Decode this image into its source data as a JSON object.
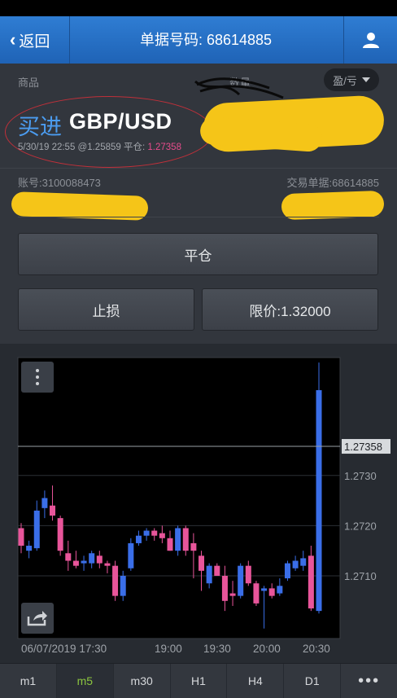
{
  "nav": {
    "back_label": "返回",
    "title": "单据号码: 68614885"
  },
  "header": {
    "product_label": "商品",
    "quantity_label": "数量",
    "pl_select": "盈/亏"
  },
  "trade": {
    "side": "买进",
    "symbol": "GBP/USD",
    "datetime": "5/30/19 22:55",
    "open_price": "@1.25859",
    "close_label": "平仓:",
    "close_price": "1.27358"
  },
  "account": {
    "account_label": "账号:3100088473",
    "order_label": "交易单据:68614885"
  },
  "buttons": {
    "close_position": "平仓",
    "stop_loss": "止损",
    "limit_price": "限价:1.32000"
  },
  "chart_data": {
    "type": "candlestick",
    "current_price": "1.27358",
    "yticks": [
      "1.2730",
      "1.2720",
      "1.2710"
    ],
    "xticks": [
      "06/07/2019 17:30",
      "19:00",
      "19:30",
      "20:00",
      "20:30"
    ],
    "ylim": [
      1.26975,
      1.27535
    ],
    "colors": {
      "up": "#3a6ee8",
      "down": "#e8559a"
    },
    "candles": [
      {
        "o": 1.27195,
        "h": 1.27205,
        "l": 1.27145,
        "c": 1.2716
      },
      {
        "o": 1.2715,
        "h": 1.2717,
        "l": 1.27135,
        "c": 1.2716
      },
      {
        "o": 1.27155,
        "h": 1.2725,
        "l": 1.2715,
        "c": 1.2723
      },
      {
        "o": 1.27235,
        "h": 1.2727,
        "l": 1.27215,
        "c": 1.27255
      },
      {
        "o": 1.2724,
        "h": 1.2728,
        "l": 1.2721,
        "c": 1.2722
      },
      {
        "o": 1.27215,
        "h": 1.2722,
        "l": 1.2714,
        "c": 1.2715
      },
      {
        "o": 1.27145,
        "h": 1.2717,
        "l": 1.2711,
        "c": 1.2713
      },
      {
        "o": 1.2713,
        "h": 1.2715,
        "l": 1.27115,
        "c": 1.2712
      },
      {
        "o": 1.27125,
        "h": 1.2714,
        "l": 1.2711,
        "c": 1.2713
      },
      {
        "o": 1.27125,
        "h": 1.2715,
        "l": 1.27115,
        "c": 1.27145
      },
      {
        "o": 1.2714,
        "h": 1.2715,
        "l": 1.27115,
        "c": 1.27125
      },
      {
        "o": 1.27125,
        "h": 1.2713,
        "l": 1.27105,
        "c": 1.2712
      },
      {
        "o": 1.2712,
        "h": 1.2713,
        "l": 1.2705,
        "c": 1.2706
      },
      {
        "o": 1.2706,
        "h": 1.2711,
        "l": 1.2705,
        "c": 1.271
      },
      {
        "o": 1.27115,
        "h": 1.27175,
        "l": 1.2711,
        "c": 1.27165
      },
      {
        "o": 1.27165,
        "h": 1.2719,
        "l": 1.2716,
        "c": 1.2718
      },
      {
        "o": 1.2718,
        "h": 1.27195,
        "l": 1.2717,
        "c": 1.2719
      },
      {
        "o": 1.2719,
        "h": 1.27195,
        "l": 1.2717,
        "c": 1.2718
      },
      {
        "o": 1.27185,
        "h": 1.272,
        "l": 1.27165,
        "c": 1.27175
      },
      {
        "o": 1.27175,
        "h": 1.2719,
        "l": 1.2715,
        "c": 1.2715
      },
      {
        "o": 1.2715,
        "h": 1.272,
        "l": 1.2714,
        "c": 1.27195
      },
      {
        "o": 1.27195,
        "h": 1.272,
        "l": 1.2714,
        "c": 1.2715
      },
      {
        "o": 1.27165,
        "h": 1.27185,
        "l": 1.27095,
        "c": 1.2715
      },
      {
        "o": 1.2714,
        "h": 1.2715,
        "l": 1.2707,
        "c": 1.2711
      },
      {
        "o": 1.27085,
        "h": 1.27125,
        "l": 1.27075,
        "c": 1.2712
      },
      {
        "o": 1.2712,
        "h": 1.27125,
        "l": 1.271,
        "c": 1.271
      },
      {
        "o": 1.271,
        "h": 1.2712,
        "l": 1.2703,
        "c": 1.2705
      },
      {
        "o": 1.27065,
        "h": 1.2709,
        "l": 1.2704,
        "c": 1.2706
      },
      {
        "o": 1.2706,
        "h": 1.27125,
        "l": 1.27055,
        "c": 1.2712
      },
      {
        "o": 1.2712,
        "h": 1.2713,
        "l": 1.2708,
        "c": 1.27085
      },
      {
        "o": 1.27085,
        "h": 1.2709,
        "l": 1.2704,
        "c": 1.27045
      },
      {
        "o": 1.2707,
        "h": 1.2708,
        "l": 1.26995,
        "c": 1.27075
      },
      {
        "o": 1.27075,
        "h": 1.27085,
        "l": 1.27055,
        "c": 1.2706
      },
      {
        "o": 1.27065,
        "h": 1.27095,
        "l": 1.2706,
        "c": 1.2708
      },
      {
        "o": 1.27095,
        "h": 1.2713,
        "l": 1.2709,
        "c": 1.27125
      },
      {
        "o": 1.27115,
        "h": 1.2714,
        "l": 1.2711,
        "c": 1.2713
      },
      {
        "o": 1.2712,
        "h": 1.2715,
        "l": 1.2711,
        "c": 1.27135
      },
      {
        "o": 1.2714,
        "h": 1.2716,
        "l": 1.2703,
        "c": 1.27035
      },
      {
        "o": 1.2703,
        "h": 1.27525,
        "l": 1.27025,
        "c": 1.2747
      }
    ]
  },
  "tabs": [
    "m1",
    "m5",
    "m30",
    "H1",
    "H4",
    "D1",
    "•••"
  ],
  "active_tab": "m5",
  "icons": {
    "user": "user-icon",
    "back": "chevron-left-icon",
    "more": "more-vertical-icon",
    "share": "share-icon",
    "dropdown": "caret-down-icon"
  }
}
